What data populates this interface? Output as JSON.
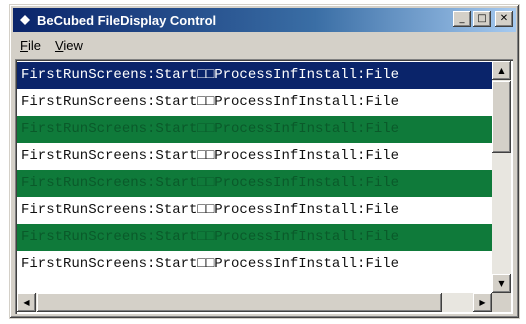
{
  "window": {
    "title": "BeCubed FileDisplay Control",
    "buttons": {
      "minimize_glyph": "_",
      "maximize_glyph": "□",
      "close_glyph": "✕"
    }
  },
  "menu": {
    "file": {
      "label_underlined": "F",
      "label_rest": "ile"
    },
    "view": {
      "label_underlined": "V",
      "label_rest": "iew"
    }
  },
  "list": {
    "rows": [
      {
        "text": "FirstRunScreens:Start□□ProcessInfInstall:File",
        "style": "selected"
      },
      {
        "text": "FirstRunScreens:Start□□ProcessInfInstall:File",
        "style": "normal"
      },
      {
        "text": "FirstRunScreens:Start□□ProcessInfInstall:File",
        "style": "green"
      },
      {
        "text": "FirstRunScreens:Start□□ProcessInfInstall:File",
        "style": "normal"
      },
      {
        "text": "FirstRunScreens:Start□□ProcessInfInstall:File",
        "style": "green"
      },
      {
        "text": "FirstRunScreens:Start□□ProcessInfInstall:File",
        "style": "normal"
      },
      {
        "text": "FirstRunScreens:Start□□ProcessInfInstall:File",
        "style": "green"
      },
      {
        "text": "FirstRunScreens:Start□□ProcessInfInstall:File",
        "style": "normal"
      }
    ]
  },
  "scrollbars": {
    "up_glyph": "▲",
    "down_glyph": "▼",
    "left_glyph": "◀",
    "right_glyph": "▶"
  },
  "colors": {
    "selected_bg": "#0a246a",
    "highlight_green": "#0f7a3a",
    "titlebar_start": "#0a246a",
    "titlebar_end": "#a6caf0"
  }
}
